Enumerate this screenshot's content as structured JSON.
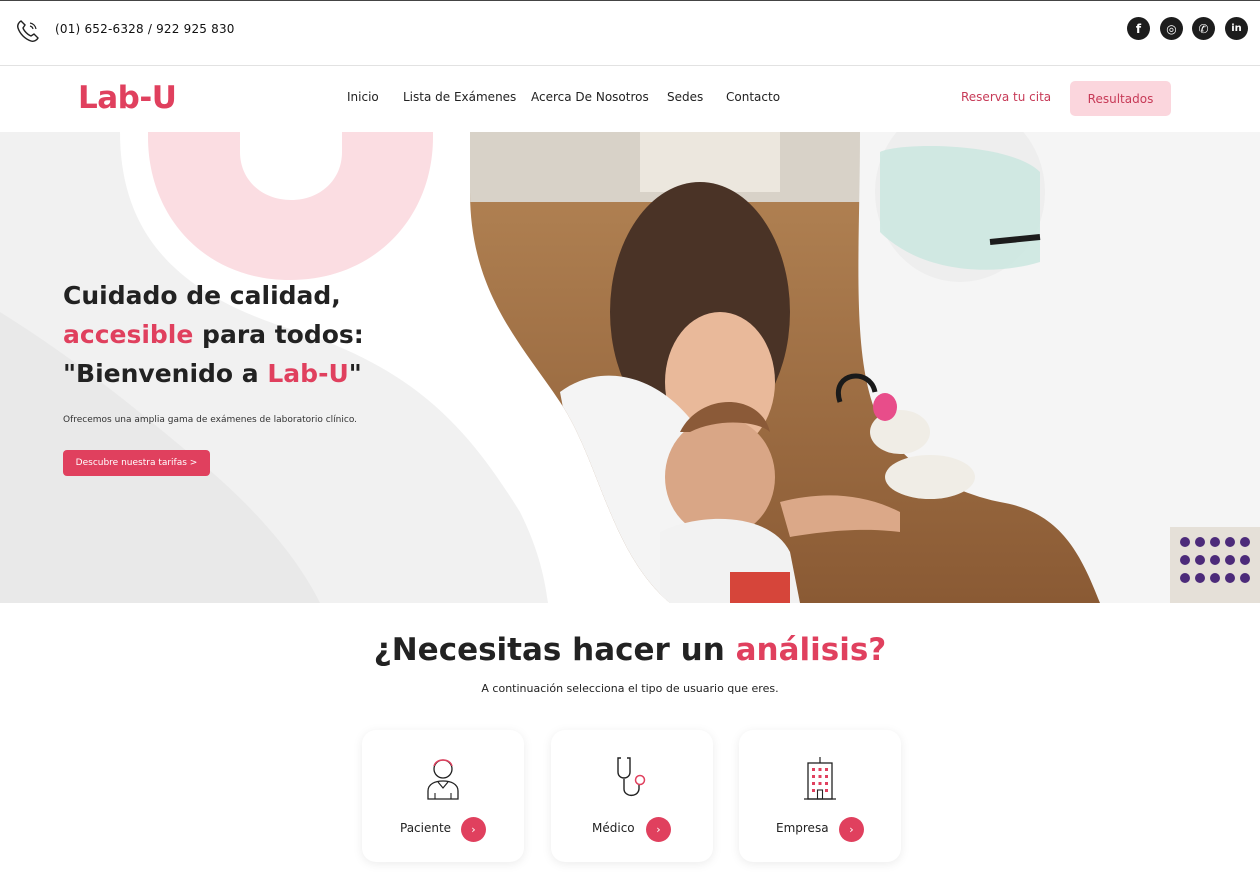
{
  "topbar": {
    "phone": "(01) 652-6328 / 922 925 830",
    "social": [
      {
        "icon": "facebook-icon",
        "glyph": "f"
      },
      {
        "icon": "instagram-icon",
        "glyph": "◎"
      },
      {
        "icon": "whatsapp-icon",
        "glyph": "✆"
      },
      {
        "icon": "linkedin-icon",
        "glyph": "in"
      }
    ]
  },
  "nav": {
    "logo": "Lab-U",
    "items": [
      "Inicio",
      "Lista de Exámenes",
      "Acerca De Nosotros",
      "Sedes",
      "Contacto"
    ],
    "reserva": "Reserva tu cita",
    "resultados": "Resultados"
  },
  "hero": {
    "line1": "Cuidado de calidad,",
    "line2_pink": "accesible",
    "line2_rest": " para todos:",
    "line3_start": "\"Bienvenido a ",
    "line3_pink": "Lab-U",
    "line3_end": "\"",
    "subtitle": "Ofrecemos una amplia gama de exámenes de laboratorio clínico.",
    "cta": "Descubre nuestra tarifas >"
  },
  "section": {
    "title_start": "¿Necesitas hacer un ",
    "title_pink": "análisis?",
    "subtitle": "A continuación selecciona el tipo de usuario que eres.",
    "cards": [
      {
        "label": "Paciente",
        "icon": "patient-icon"
      },
      {
        "label": "Médico",
        "icon": "stethoscope-icon"
      },
      {
        "label": "Empresa",
        "icon": "building-icon"
      }
    ]
  },
  "colors": {
    "accent": "#e0405e",
    "accent_light": "#fbd6dd",
    "text": "#222222"
  }
}
